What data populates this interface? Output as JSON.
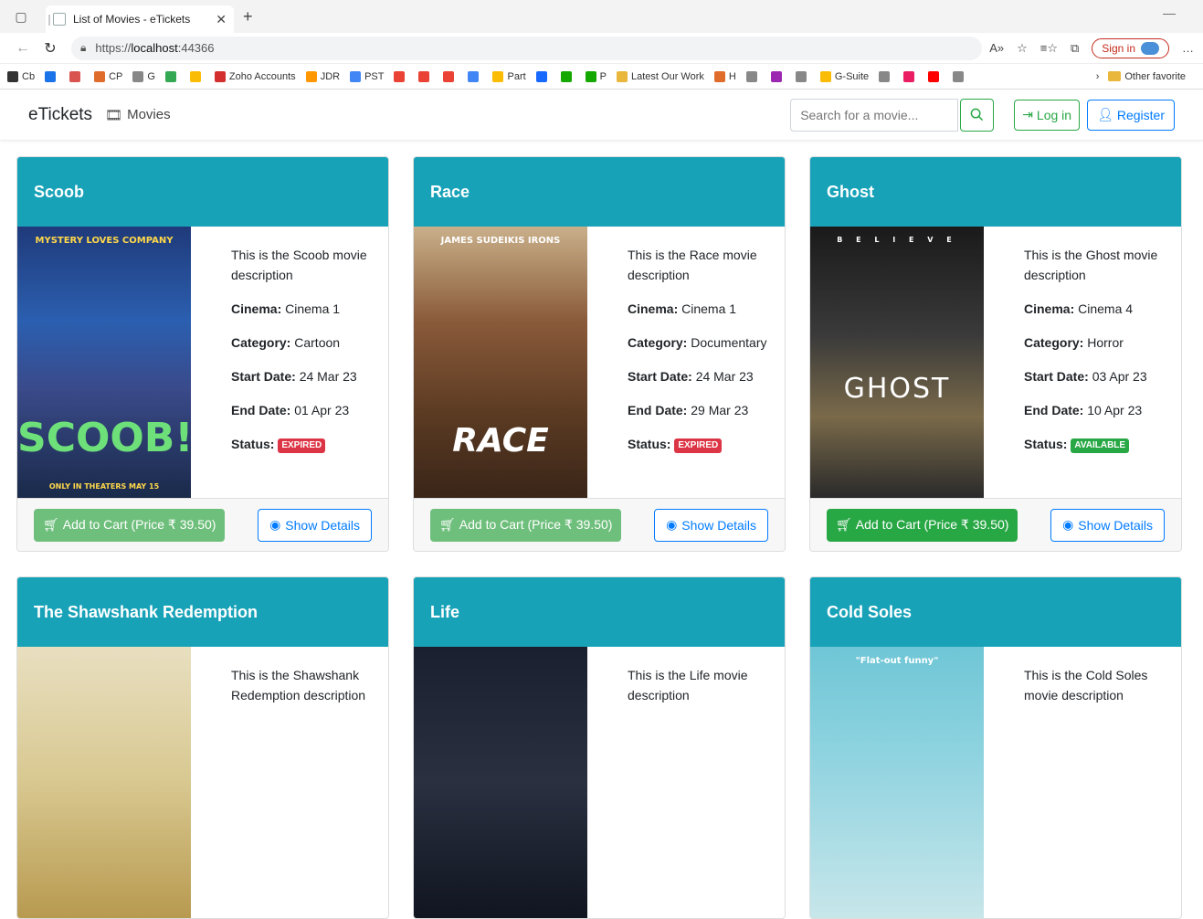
{
  "browser": {
    "tab_title": "List of Movies - eTickets",
    "url_prefix": "https://",
    "url_host": "localhost",
    "url_port": ":44366",
    "signin_label": "Sign in"
  },
  "bookmarks": [
    {
      "label": "Cb",
      "color": "#333333"
    },
    {
      "label": "",
      "color": "#1a73e8"
    },
    {
      "label": "",
      "color": "#d9534f"
    },
    {
      "label": "CP",
      "color": "#e06c2b"
    },
    {
      "label": "G",
      "color": "#888888"
    },
    {
      "label": "",
      "color": "#34a853"
    },
    {
      "label": "",
      "color": "#fbbc05"
    },
    {
      "label": "Zoho Accounts",
      "color": "#d32f2f"
    },
    {
      "label": "JDR",
      "color": "#ff9800"
    },
    {
      "label": "PST",
      "color": "#4285f4"
    },
    {
      "label": "",
      "color": "#ea4335"
    },
    {
      "label": "",
      "color": "#ea4335"
    },
    {
      "label": "",
      "color": "#ea4335"
    },
    {
      "label": "",
      "color": "#4285f4"
    },
    {
      "label": "Part",
      "color": "#fbbc05"
    },
    {
      "label": "",
      "color": "#1769ff"
    },
    {
      "label": "",
      "color": "#14a800"
    },
    {
      "label": "P",
      "color": "#14a800"
    },
    {
      "label": "Latest Our Work",
      "color": "#e8b73b"
    },
    {
      "label": "H",
      "color": "#e06c2b"
    },
    {
      "label": "",
      "color": "#888888"
    },
    {
      "label": "",
      "color": "#9c27b0"
    },
    {
      "label": "",
      "color": "#888888"
    },
    {
      "label": "G-Suite",
      "color": "#fbbc05"
    },
    {
      "label": "",
      "color": "#888888"
    },
    {
      "label": "",
      "color": "#e91e63"
    },
    {
      "label": "",
      "color": "#ff0000"
    },
    {
      "label": "",
      "color": "#888888"
    }
  ],
  "other_favorites": "Other favorite",
  "nav": {
    "brand": "eTickets",
    "movies_link": "Movies",
    "search_placeholder": "Search for a movie...",
    "login_label": "Log in",
    "register_label": "Register"
  },
  "labels": {
    "cinema": "Cinema:",
    "category": "Category:",
    "start": "Start Date:",
    "end": "End Date:",
    "status": "Status:",
    "add_to_cart": "Add to Cart (Price ₹ 39.50)",
    "show_details": "Show Details"
  },
  "colors": {
    "header": "#17a2b8",
    "expired": "#dc3545",
    "available": "#28a745",
    "cart_disabled": "#6fbf7c",
    "cart_active": "#28a745"
  },
  "movies": [
    {
      "title": "Scoob",
      "description": "This is the Scoob movie description",
      "cinema": "Cinema 1",
      "category": "Cartoon",
      "start": "24 Mar 23",
      "end": "01 Apr 23",
      "status": "EXPIRED",
      "poster_top": "MYSTERY LOVES COMPANY",
      "poster_title": "SCOOB!",
      "poster_bottom": "ONLY IN THEATERS MAY 15"
    },
    {
      "title": "Race",
      "description": "This is the Race movie description",
      "cinema": "Cinema 1",
      "category": "Documentary",
      "start": "24 Mar 23",
      "end": "29 Mar 23",
      "status": "EXPIRED",
      "poster_top": "JAMES  SUDEIKIS  IRONS",
      "poster_title": "RACE",
      "poster_bottom": ""
    },
    {
      "title": "Ghost",
      "description": "This is the Ghost movie description",
      "cinema": "Cinema 4",
      "category": "Horror",
      "start": "03 Apr 23",
      "end": "10 Apr 23",
      "status": "AVAILABLE",
      "poster_top": "B E L I E V E",
      "poster_title": "GHOST",
      "poster_bottom": ""
    },
    {
      "title": "The Shawshank Redemption",
      "description": "This is the Shawshank Redemption description"
    },
    {
      "title": "Life",
      "description": "This is the Life movie description"
    },
    {
      "title": "Cold Soles",
      "description": "This is the Cold Soles movie description",
      "poster_top": "\"Flat-out funny\""
    }
  ]
}
